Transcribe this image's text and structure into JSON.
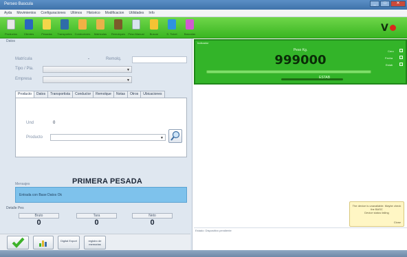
{
  "window": {
    "title": "Perseo Bascula",
    "buttons": [
      "_",
      "□",
      "✕"
    ]
  },
  "menu": [
    "Ayda",
    "Movimientos",
    "Configuraciones",
    "Ultimos",
    "Historico",
    "Modificacion",
    "Utilidades",
    "Info"
  ],
  "toolbar": {
    "items": [
      {
        "label": "Productos",
        "icon": "box-icon",
        "color": "#e7e7e7"
      },
      {
        "label": "Clientes",
        "icon": "user-icon",
        "color": "#2a66bf"
      },
      {
        "label": "Pesadas",
        "icon": "scale-icon",
        "color": "#f4d64a"
      },
      {
        "label": "Transportes",
        "icon": "truck-icon",
        "color": "#2f6ca8"
      },
      {
        "label": "Conductores",
        "icon": "driver-icon",
        "color": "#f1b145"
      },
      {
        "label": "Matriculas",
        "icon": "plate-icon",
        "color": "#e8b24a"
      },
      {
        "label": "Remolques",
        "icon": "trailer-icon",
        "color": "#7b5a2a"
      },
      {
        "label": "Peso Manual",
        "icon": "weight-icon",
        "color": "#d8e4ef"
      },
      {
        "label": "Buscar",
        "icon": "search-icon",
        "color": "#f5c334"
      },
      {
        "label": "S. Ticket",
        "icon": "ticket-icon",
        "color": "#2e92e0"
      },
      {
        "label": "Basculas",
        "icon": "gear-icon",
        "color": "#d05ad0"
      }
    ]
  },
  "brand": {
    "accent": "#d9281c"
  },
  "left": {
    "section": "Datos",
    "matricula_label": "Matrícula",
    "remolque_label": "Remolq.",
    "tipo_label": "Tipo / Pla.",
    "empresa_label": "Empresa",
    "tabs": [
      "Producto",
      "Datos",
      "Transportista",
      "Conductor",
      "Remolque",
      "Notas",
      "Otros",
      "Ubicaciones"
    ],
    "und_label": "Und",
    "und_value": "0",
    "producto_label": "Producto",
    "primera": "PRIMERA PESADA",
    "mensajes_label": "Mensajes",
    "mensaje": "Entrada con Base Datos Ok",
    "detalle_label": "Detalle Pes",
    "weights": [
      {
        "label": "Bruto",
        "value": "0"
      },
      {
        "label": "Tara",
        "value": "0"
      },
      {
        "label": "Neto",
        "value": "0"
      }
    ],
    "buttons": {
      "ok_icon": "checkmark-icon",
      "chart_icon": "chart-icon",
      "digital": "Digital Export",
      "registro": "registro de memorias"
    }
  },
  "indicator": {
    "header": "Indicador",
    "unit": "Peso Kg.",
    "value": "999000",
    "stable_label": "ESTAB",
    "options": [
      {
        "label": "Cero"
      },
      {
        "label": "Fecha"
      },
      {
        "label": "Estab"
      }
    ]
  },
  "tooltip": {
    "text": "The device is unavailable. Maybe check the BASC",
    "extra": "Device status failing",
    "close": "Close"
  },
  "status": "Estado: Dispositivo pendiente"
}
